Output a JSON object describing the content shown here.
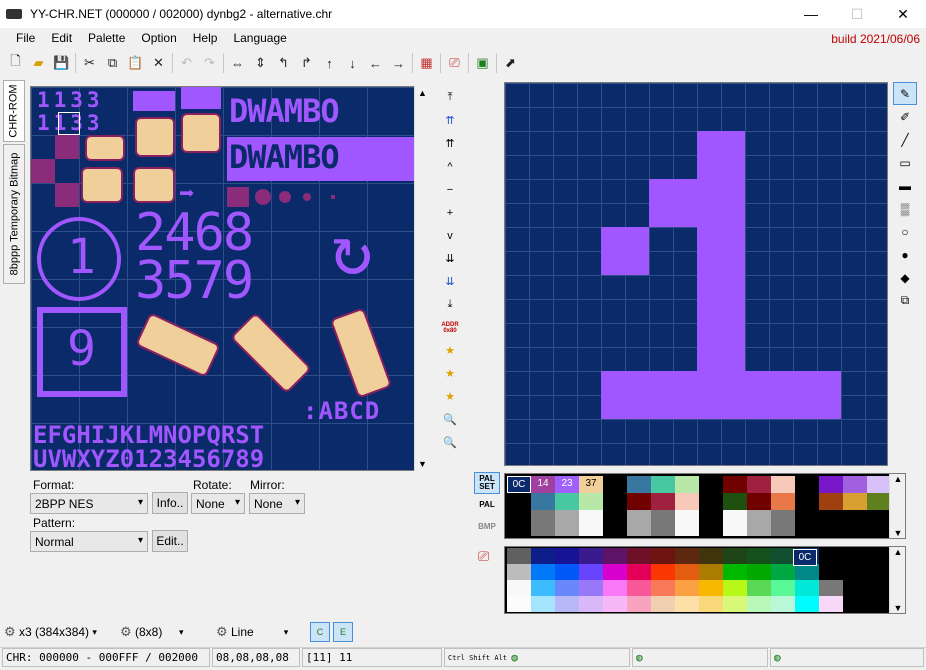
{
  "window": {
    "title": "YY-CHR.NET (000000 / 002000) dynbg2 - alternative.chr",
    "minimize": "—",
    "maximize": "☐",
    "close": "✕"
  },
  "menu": [
    "File",
    "Edit",
    "Palette",
    "Option",
    "Help",
    "Language"
  ],
  "build": "build 2021/06/06",
  "sidetabs": [
    "CHR-ROM",
    "8bppp Temporary Bitmap"
  ],
  "chr_tiles": {
    "row1": "1133",
    "row2": "1133",
    "dwambo1": "DWAMBO",
    "dwambo2": "DWAMBO",
    "circ_one": "1",
    "digits_top": "2468",
    "digits_bottom": "3579",
    "boxed_nine": "9",
    "abcd": ":ABCD",
    "letters1": "EFGHIJKLMNOPQRST",
    "letters2": "UVWXYZ0123456789"
  },
  "nav_icons": [
    "double-up-end",
    "double-up-blue",
    "double-up",
    "up",
    "minus",
    "plus",
    "down",
    "double-down",
    "double-down-blue",
    "double-down-end",
    "addr",
    "star-right",
    "star-up",
    "star-down",
    "zoom-in",
    "zoom-out"
  ],
  "addr_label": "ADDR\n0x80",
  "format": {
    "label": "Format:",
    "value": "2BPP NES",
    "info_button": "Info.."
  },
  "rotate": {
    "label": "Rotate:",
    "value": "None"
  },
  "mirror": {
    "label": "Mirror:",
    "value": "None"
  },
  "pattern": {
    "label": "Pattern:",
    "value": "Normal",
    "edit_button": "Edit.."
  },
  "palette_buttons": [
    "PAL SET",
    "PAL",
    "BMP"
  ],
  "palette_selected": [
    {
      "label": "0C",
      "color": "#0a2a6a"
    },
    {
      "label": "14",
      "color": "#a040a0"
    },
    {
      "label": "23",
      "color": "#a060ff"
    },
    {
      "label": "37",
      "color": "#f0cf9a"
    }
  ],
  "palette_full_label": "0C",
  "bottom": {
    "zoom": "x3 (384x384)",
    "grid": "(8x8)",
    "tool": "Line"
  },
  "status": {
    "chr": "CHR: 000000 - 000FFF / 002000",
    "bytes": "08,08,08,08",
    "sel": "[11] 11",
    "keys": "Ctrl Shift Alt"
  },
  "colors": {
    "bg": "#0a2a6a",
    "purple": "#a157ff",
    "tan": "#f0cf9a",
    "magenta": "#8a2c7a",
    "build_red": "#c00000"
  }
}
